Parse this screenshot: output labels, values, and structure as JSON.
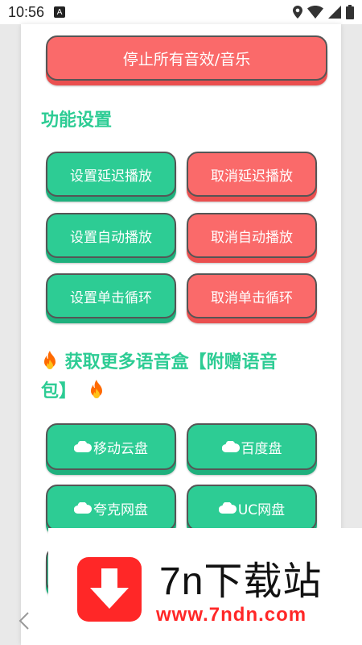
{
  "status_bar": {
    "time": "10:56",
    "notification_letter": "A"
  },
  "stop_all_button": "停止所有音效/音乐",
  "function_settings": {
    "title": "功能设置",
    "buttons": [
      {
        "label": "设置延迟播放"
      },
      {
        "label": "取消延迟播放"
      },
      {
        "label": "设置自动播放"
      },
      {
        "label": "取消自动播放"
      },
      {
        "label": "设置单击循环"
      },
      {
        "label": "取消单击循环"
      }
    ]
  },
  "more_boxes": {
    "title_line1": "获取更多语音盒【附赠语音",
    "title_line2": "包】",
    "links": [
      {
        "label": "移动云盘"
      },
      {
        "label": "百度盘"
      },
      {
        "label": "夸克网盘"
      },
      {
        "label": "UC网盘"
      }
    ]
  },
  "watermark": {
    "title": "7n下载站",
    "url": "www.7ndn.com"
  },
  "colors": {
    "green": "#2dcc94",
    "red": "#fa6a6a"
  }
}
